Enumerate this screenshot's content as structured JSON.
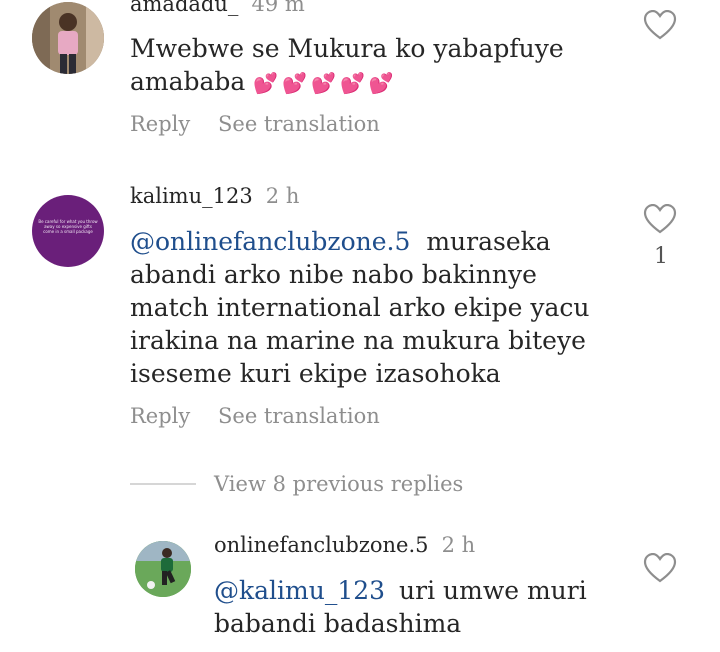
{
  "comments": [
    {
      "username": "amadadu_",
      "time": "49 m",
      "text": "Mwebwe se Mukura ko yabapfuye amababa",
      "emojis": "💕💕💕💕💕",
      "reply_label": "Reply",
      "translate_label": "See translation"
    },
    {
      "username": "kalimu_123",
      "time": "2 h",
      "mention": "@onlinefanclubzone.5",
      "text": "muraseka abandi arko nibe nabo bakinnye match international arko ekipe yacu irakina na marine na mukura  biteye iseseme kuri ekipe izasohoka",
      "avatar_caption": "Be careful for what you throw away so expensive gifts come in a small package",
      "likes": "1",
      "reply_label": "Reply",
      "translate_label": "See translation"
    }
  ],
  "view_replies_label": "View 8 previous replies",
  "reply": {
    "username": "onlinefanclubzone.5",
    "time": "2 h",
    "mention": "@kalimu_123",
    "text": "uri umwe muri babandi badashima"
  },
  "colors": {
    "avatar_purple": "#6a1f7a",
    "mention": "#1f4e8c",
    "meta_gray": "#8e8e8e"
  }
}
